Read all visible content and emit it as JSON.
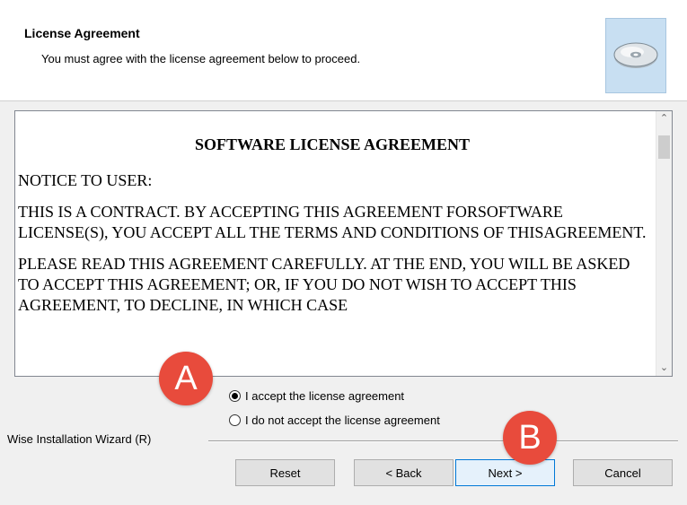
{
  "header": {
    "title": "License Agreement",
    "subtitle": "You must agree with the license agreement below to proceed.",
    "icon": "cd-disc-icon"
  },
  "license": {
    "title": "SOFTWARE LICENSE AGREEMENT",
    "paragraphs": [
      "NOTICE TO USER:",
      "THIS IS A CONTRACT. BY ACCEPTING THIS AGREEMENT FORSOFTWARE LICENSE(S), YOU ACCEPT ALL THE TERMS AND CONDITIONS OF THISAGREEMENT.",
      "PLEASE READ THIS AGREEMENT CAREFULLY. AT THE END, YOU WILL BE ASKED TO ACCEPT THIS AGREEMENT; OR, IF YOU DO NOT WISH TO ACCEPT THIS AGREEMENT, TO DECLINE, IN WHICH CASE"
    ]
  },
  "options": {
    "accept_label": "I accept the license agreement",
    "decline_label": "I do not accept the license agreement",
    "selected": "accept"
  },
  "footer": {
    "wizard_label": "Wise Installation Wizard (R)"
  },
  "buttons": {
    "reset": "Reset",
    "back": "< Back",
    "next": "Next >",
    "cancel": "Cancel"
  },
  "annotations": {
    "a": "A",
    "b": "B",
    "color": "#e84b3c"
  }
}
